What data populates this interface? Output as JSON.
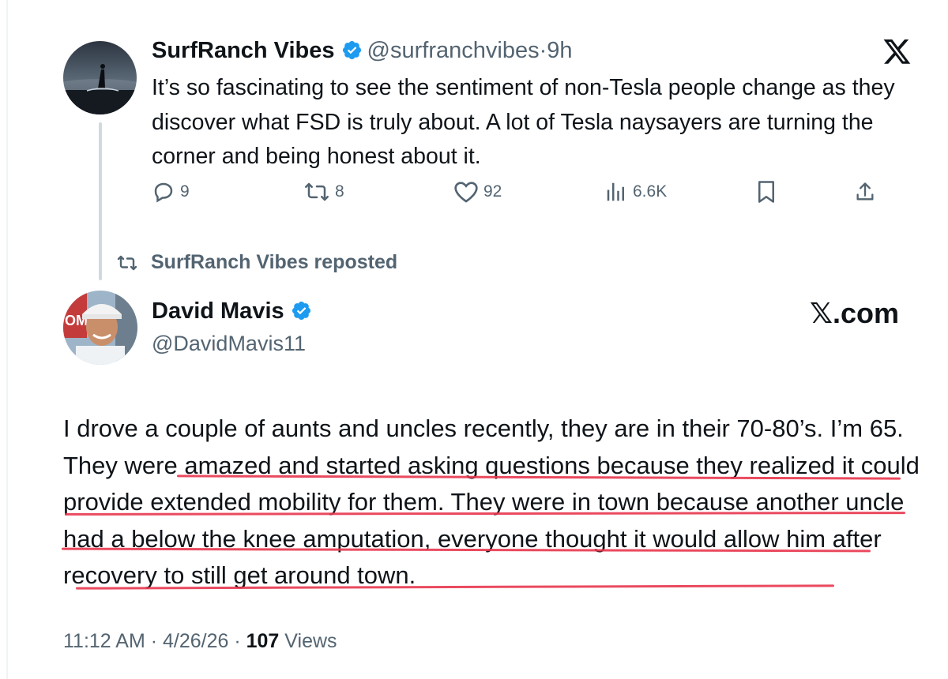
{
  "tweet1": {
    "author_name": "SurfRanch Vibes",
    "handle": "@surfranchvibes",
    "separator": "·",
    "age": "9h",
    "text": "It’s so fascinating to see the sentiment of non-Tesla people change as they discover what FSD is truly about. A lot of Tesla naysayers are turning the corner and being honest about it.",
    "verified": true,
    "actions": {
      "replies": "9",
      "reposts": "8",
      "likes": "92",
      "views": "6.6K"
    }
  },
  "repost_notice": "SurfRanch Vibes reposted",
  "tweet2": {
    "author_name": "David Mavis",
    "handle": "@DavidMavis11",
    "verified": true,
    "text": "I drove a couple of aunts and uncles recently, they are in their 70-80’s. I’m 65.  They were amazed and started asking questions because they realized it could provide extended mobility for them. They were in town because another uncle had a below the knee amputation,  everyone thought it would allow him after recovery to still get around town.",
    "timestamp": "11:12 AM · 4/26/26 · ",
    "views_count": "107",
    "views_label": " Views"
  },
  "brand": {
    "x_logo_icon": "x-logo-icon",
    "watermark": "𝕏.com"
  },
  "colors": {
    "verified_blue": "#1d9bf0",
    "secondary_text": "#536471",
    "underline_red": "#e8364e"
  }
}
